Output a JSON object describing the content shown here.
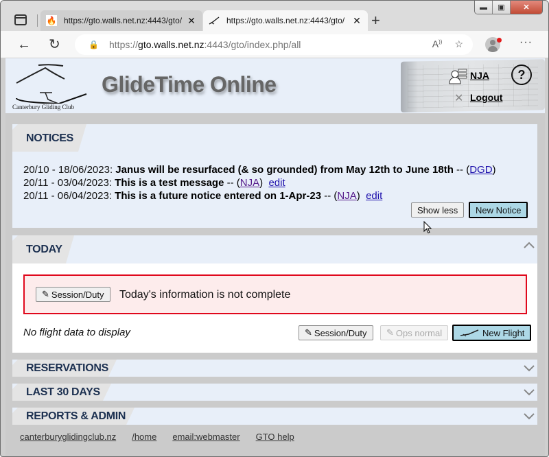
{
  "browser": {
    "tabs": [
      {
        "title": "https://gto.walls.net.nz:4443/gto/",
        "favicon": "fire-icon",
        "active": false
      },
      {
        "title": "https://gto.walls.net.nz:4443/gto/",
        "favicon": "glider-icon",
        "active": true
      }
    ],
    "url": {
      "scheme": "https://",
      "host": "gto.walls.net.nz",
      "rest": ":4443/gto/index.php/all"
    }
  },
  "header": {
    "site_title": "GlideTime Online",
    "logo_caption": "Canterbury  Gliding  Club",
    "user": "NJA",
    "logout": "Logout",
    "help": "?"
  },
  "notices": {
    "title": "NOTICES",
    "items": [
      {
        "dates": "20/10 - 18/06/2023:",
        "message": "Janus will be resurfaced (& so grounded) from May 12th to June 18th",
        "sep": " -- (",
        "author": "DGD",
        "close": ")",
        "edit": ""
      },
      {
        "dates": "20/11 - 03/04/2023:",
        "message": "This is a test message",
        "sep": " -- (",
        "author": "NJA",
        "close": ")",
        "edit": "edit"
      },
      {
        "dates": "20/11 - 06/04/2023:",
        "message": "This is a future notice entered on 1-Apr-23",
        "sep": " -- (",
        "author": "NJA",
        "close": ")",
        "edit": "edit"
      }
    ],
    "show_less": "Show less",
    "new_notice": "New Notice"
  },
  "today": {
    "title": "TODAY",
    "alert_button": "Session/Duty",
    "alert_text": "Today's information is not complete",
    "no_data": "No flight data to display",
    "buttons": {
      "session_duty": "Session/Duty",
      "ops_normal": "Ops normal",
      "new_flight": "New Flight"
    }
  },
  "sections": [
    {
      "title": "RESERVATIONS"
    },
    {
      "title": "LAST 30 DAYS"
    },
    {
      "title": "REPORTS & ADMIN"
    }
  ],
  "footer": {
    "links": [
      "canterburyglidingclub.nz",
      "/home",
      "email:webmaster",
      "GTO help"
    ]
  },
  "colors": {
    "panel_bg": "#e8eff9",
    "section_title": "#1c3050",
    "alert_border": "#e0081c",
    "alert_bg": "#fdecec",
    "primary_button": "#add8e6"
  }
}
